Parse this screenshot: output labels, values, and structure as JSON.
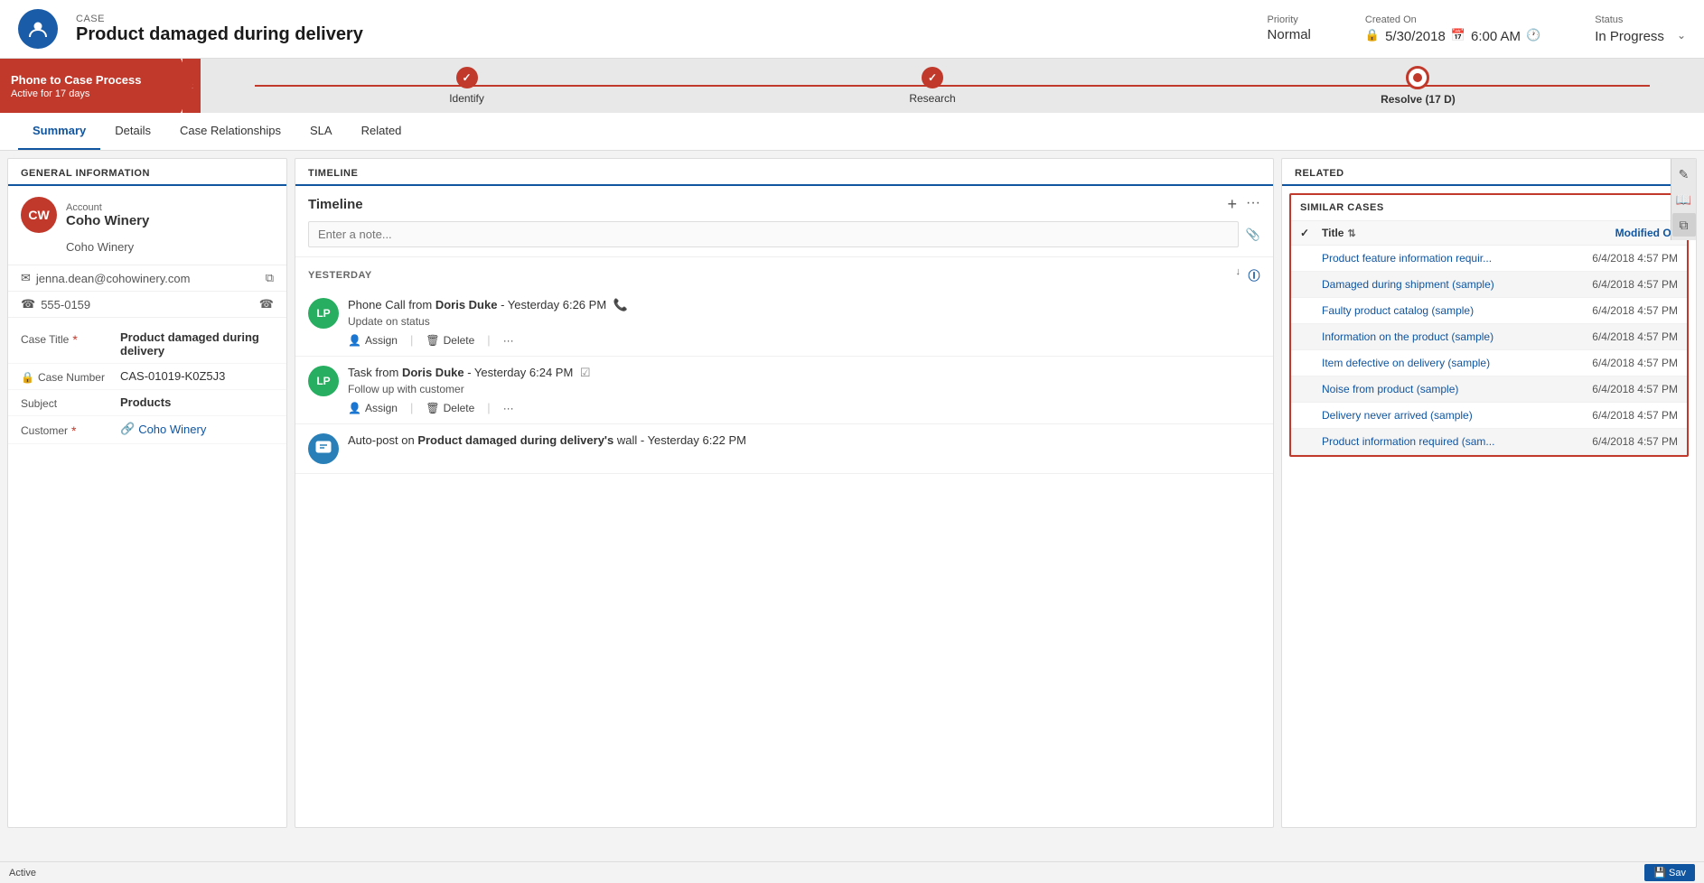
{
  "header": {
    "entity_label": "CASE",
    "title": "Product damaged during delivery",
    "avatar_initials": "👤",
    "priority_label": "Priority",
    "priority_value": "Normal",
    "created_on_label": "Created On",
    "created_date": "5/30/2018",
    "created_time": "6:00 AM",
    "status_label": "Status",
    "status_value": "In Progress"
  },
  "process_bar": {
    "label_title": "Phone to Case Process",
    "label_sub": "Active for 17 days",
    "steps": [
      {
        "id": "identify",
        "label": "Identify",
        "state": "done"
      },
      {
        "id": "research",
        "label": "Research",
        "state": "done"
      },
      {
        "id": "resolve",
        "label": "Resolve  (17 D)",
        "state": "active"
      }
    ]
  },
  "tabs": [
    {
      "id": "summary",
      "label": "Summary",
      "active": true
    },
    {
      "id": "details",
      "label": "Details",
      "active": false
    },
    {
      "id": "case-relationships",
      "label": "Case Relationships",
      "active": false
    },
    {
      "id": "sla",
      "label": "SLA",
      "active": false
    },
    {
      "id": "related",
      "label": "Related",
      "active": false
    }
  ],
  "general_information": {
    "section_title": "GENERAL INFORMATION",
    "account_label": "Account",
    "account_initials": "CW",
    "account_name": "Coho Winery",
    "company_name": "Coho Winery",
    "email": "jenna.dean@cohowinery.com",
    "phone": "555-0159",
    "form_fields": [
      {
        "label": "Case Title",
        "required": true,
        "value": "Product damaged during delivery",
        "bold": true,
        "lock": false
      },
      {
        "label": "Case Number",
        "required": false,
        "value": "CAS-01019-K0Z5J3",
        "bold": false,
        "lock": true
      },
      {
        "label": "Subject",
        "required": false,
        "value": "Products",
        "bold": true,
        "lock": false
      },
      {
        "label": "Customer",
        "required": true,
        "value": "Coho Winery",
        "bold": false,
        "lock": false,
        "blue": true
      }
    ]
  },
  "timeline": {
    "section_title": "TIMELINE",
    "header_title": "Timeline",
    "note_placeholder": "Enter a note...",
    "group_yesterday": "YESTERDAY",
    "items": [
      {
        "id": "item1",
        "avatar_initials": "LP",
        "avatar_bg": "#27ae60",
        "type": "phone",
        "title_prefix": "Phone Call from ",
        "author": "Doris Duke",
        "time": "Yesterday 6:26 PM",
        "subtitle": "Update on status",
        "actions": [
          "Assign",
          "Delete",
          "..."
        ]
      },
      {
        "id": "item2",
        "avatar_initials": "LP",
        "avatar_bg": "#27ae60",
        "type": "task",
        "title_prefix": "Task from ",
        "author": "Doris Duke",
        "time": "Yesterday 6:24 PM",
        "subtitle": "Follow up with customer",
        "actions": [
          "Assign",
          "Delete",
          "..."
        ]
      },
      {
        "id": "item3",
        "avatar_initials": "💬",
        "avatar_bg": "#2980b9",
        "type": "auto-post",
        "title_prefix": "Auto-post on ",
        "bold_text": "Product damaged during delivery's",
        "title_suffix": " wall",
        "time": "Yesterday 6:22 PM",
        "subtitle": ""
      }
    ]
  },
  "related": {
    "section_title": "RELATED",
    "similar_cases": {
      "header": "SIMILAR CASES",
      "col_title": "Title",
      "col_modified": "Modified On",
      "rows": [
        {
          "id": "r1",
          "title": "Product feature information requir...",
          "modified": "6/4/2018 4:57 PM",
          "shaded": false
        },
        {
          "id": "r2",
          "title": "Damaged during shipment (sample)",
          "modified": "6/4/2018 4:57 PM",
          "shaded": true
        },
        {
          "id": "r3",
          "title": "Faulty product catalog (sample)",
          "modified": "6/4/2018 4:57 PM",
          "shaded": false
        },
        {
          "id": "r4",
          "title": "Information on the product (sample)",
          "modified": "6/4/2018 4:57 PM",
          "shaded": true
        },
        {
          "id": "r5",
          "title": "Item defective on delivery (sample)",
          "modified": "6/4/2018 4:57 PM",
          "shaded": false
        },
        {
          "id": "r6",
          "title": "Noise from product (sample)",
          "modified": "6/4/2018 4:57 PM",
          "shaded": true
        },
        {
          "id": "r7",
          "title": "Delivery never arrived (sample)",
          "modified": "6/4/2018 4:57 PM",
          "shaded": false
        },
        {
          "id": "r8",
          "title": "Product information required (sam...",
          "modified": "6/4/2018 4:57 PM",
          "shaded": true
        }
      ]
    }
  },
  "status_bar": {
    "status_text": "Active",
    "save_label": "Sav"
  },
  "icons": {
    "pencil": "✎",
    "book": "📖",
    "copy": "⧉",
    "plus": "+",
    "ellipsis": "···",
    "down_arrow": "↓",
    "sort": "⇅",
    "check": "✓",
    "paperclip": "📎",
    "assign": "👤",
    "delete_trash": "🗑",
    "email": "✉",
    "phone": "☎",
    "lock": "🔒",
    "chevron_down": "⌄",
    "calendar": "📅",
    "clock": "🕐",
    "collapse": "‹",
    "person": "🧑",
    "task_check": "☑"
  }
}
